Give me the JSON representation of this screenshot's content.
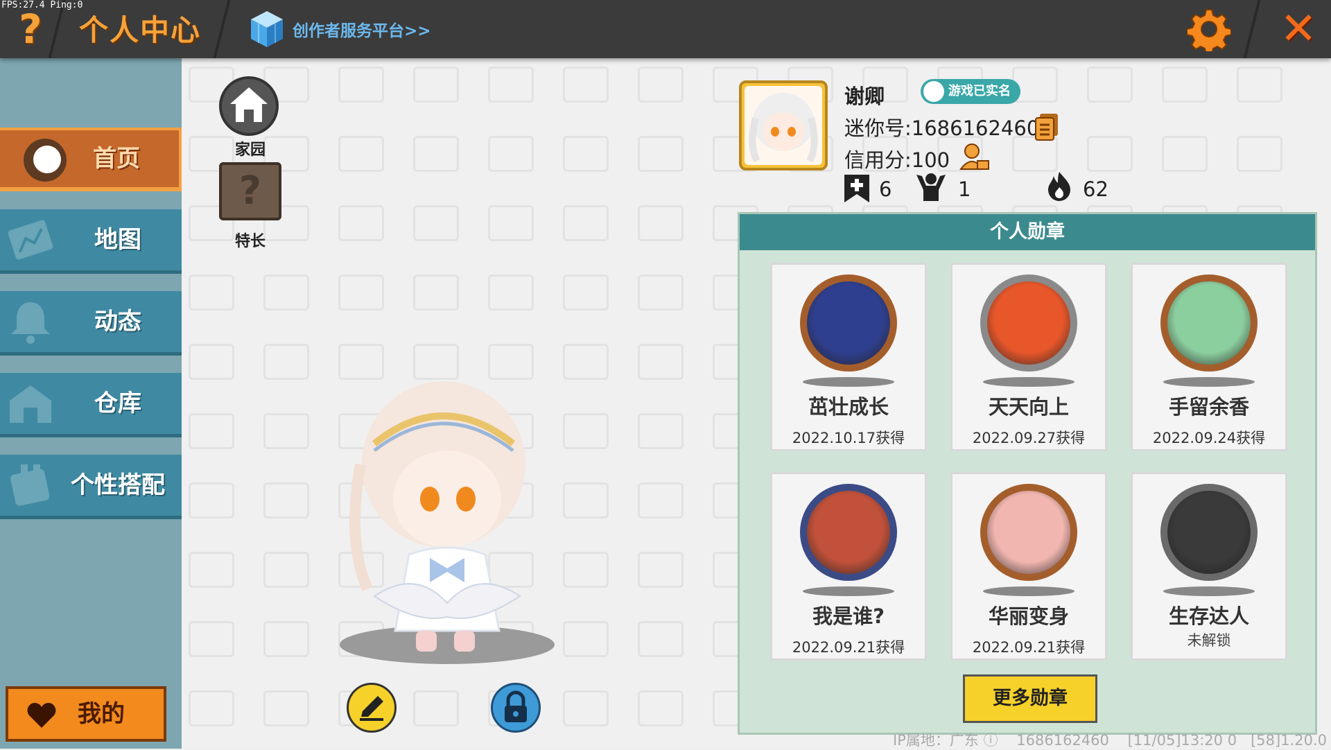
{
  "overlay": {
    "fps": "FPS:27.4  Ping:0"
  },
  "topbar": {
    "help": "?",
    "title": "个人中心",
    "creator_link": "创作者服务平台>>",
    "close": "✕"
  },
  "sidebar": {
    "items": [
      {
        "label": "首页",
        "icon": "home-toggle-icon",
        "active": true
      },
      {
        "label": "地图",
        "icon": "map-icon"
      },
      {
        "label": "动态",
        "icon": "bell-icon"
      },
      {
        "label": "仓库",
        "icon": "warehouse-icon"
      },
      {
        "label": "个性搭配",
        "icon": "outfit-icon"
      }
    ],
    "mine_button": "我的"
  },
  "shortcuts": {
    "home_label": "家园",
    "skill_label": "特长",
    "skill_icon_text": "?"
  },
  "profile": {
    "name": "谢卿",
    "realname_badge": "游戏已实名",
    "mini_id": "迷你号:1686162460",
    "credit": "信用分:100",
    "stats": {
      "follow": "6",
      "fans": "1",
      "popularity": "62"
    }
  },
  "medals": {
    "header": "个人勋章",
    "items": [
      {
        "name": "茁壮成长",
        "date": "2022.10.17获得",
        "ring_color": "#a45e2c",
        "fill_color": "#2f3f8f"
      },
      {
        "name": "天天向上",
        "date": "2022.09.27获得",
        "ring_color": "#8a8a8a",
        "fill_color": "#e8572a"
      },
      {
        "name": "手留余香",
        "date": "2022.09.24获得",
        "ring_color": "#a45e2c",
        "fill_color": "#8ccf9f"
      },
      {
        "name": "我是谁?",
        "date": "2022.09.21获得",
        "ring_color": "#3b4b86",
        "fill_color": "#c1513a"
      },
      {
        "name": "华丽变身",
        "date": "2022.09.21获得",
        "ring_color": "#a45e2c",
        "fill_color": "#f2b6b0"
      },
      {
        "name": "生存达人",
        "date": "未解锁",
        "ring_color": "#6a6a6a",
        "fill_color": "#3a3a3a",
        "locked": true
      }
    ],
    "more_button": "更多勋章"
  },
  "footer": {
    "ip": "IP属地：广东",
    "id": "1686162460",
    "time": "[11/05]13:20 0",
    "version": "[58]1.20.0"
  },
  "colors": {
    "topbar_bg": "#3b3b3b",
    "accent_orange": "#f6a23a",
    "sidebar_blue": "#3f8aa2",
    "medal_panel": "#cfe4d7",
    "medal_header": "#3b8a8e"
  }
}
